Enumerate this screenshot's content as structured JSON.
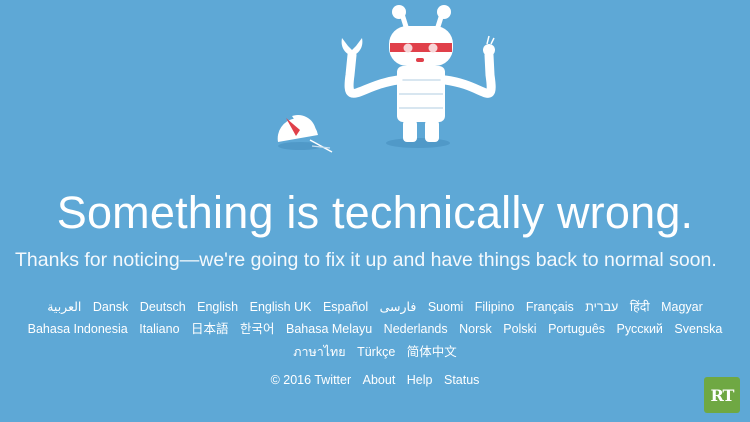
{
  "headline": "Something is technically wrong.",
  "subline": "Thanks for noticing—we're going to fix it up and have things back to normal soon.",
  "languages": {
    "row1": [
      "العربية",
      "Dansk",
      "Deutsch",
      "English",
      "English UK",
      "Español",
      "فارسی",
      "Suomi",
      "Filipino",
      "Français",
      "עברית",
      "हिंदी",
      "Magyar"
    ],
    "row2": [
      "Bahasa Indonesia",
      "Italiano",
      "日本語",
      "한국어",
      "Bahasa Melayu",
      "Nederlands",
      "Norsk",
      "Polski",
      "Português",
      "Русский",
      "Svenska"
    ],
    "row3": [
      "ภาษาไทย",
      "Türkçe",
      "简体中文"
    ]
  },
  "footer": {
    "copyright": "© 2016 Twitter",
    "about": "About",
    "help": "Help",
    "status": "Status"
  },
  "watermark": {
    "text": "RT",
    "color": "#6fa843"
  },
  "colors": {
    "background": "#5ea8d6",
    "robot_accent": "#e0404a"
  }
}
